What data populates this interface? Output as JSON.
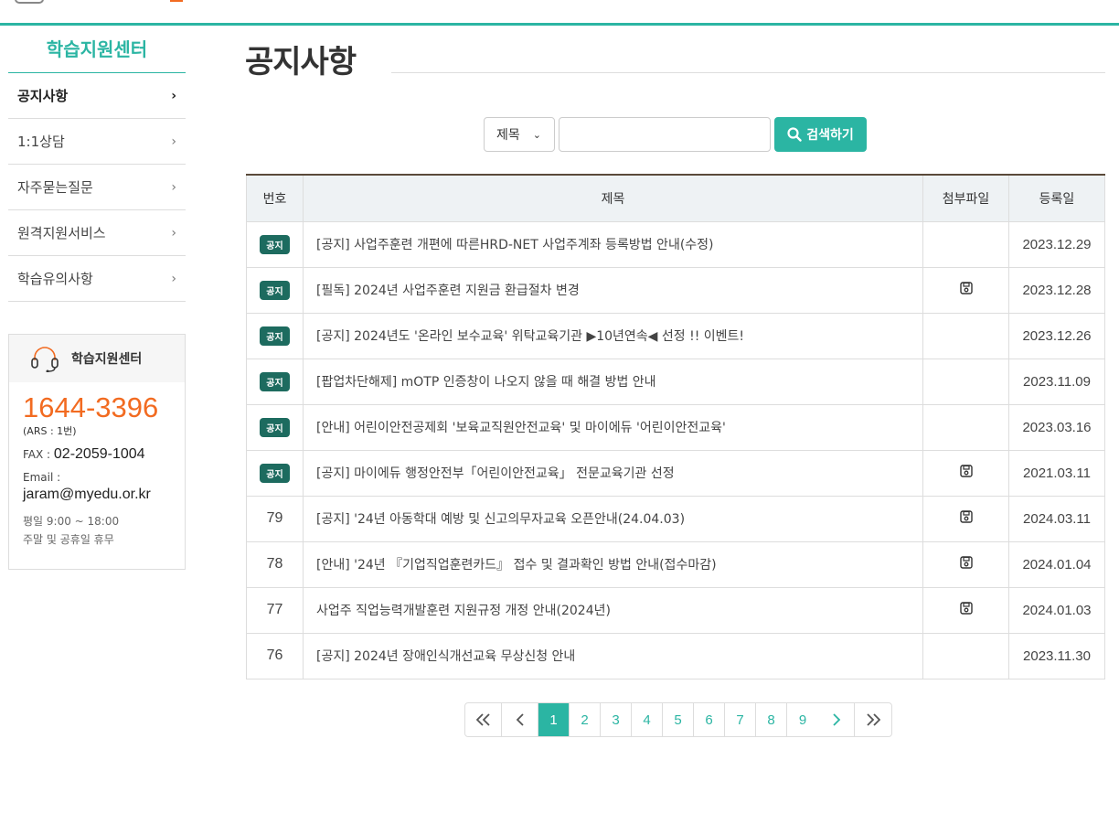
{
  "colors": {
    "accent": "#2bb5a3",
    "badge": "#1d6b5f",
    "phone": "#f26b21"
  },
  "sidebar": {
    "title": "학습지원센터",
    "items": [
      {
        "label": "공지사항",
        "active": true
      },
      {
        "label": "1:1상담"
      },
      {
        "label": "자주묻는질문"
      },
      {
        "label": "원격지원서비스"
      },
      {
        "label": "학습유의사항"
      }
    ]
  },
  "support": {
    "title": "학습지원센터",
    "phone": "1644-3396",
    "ars": "(ARS : 1번)",
    "fax_label": "FAX : ",
    "fax": "02-2059-1004",
    "email_label": "Email :",
    "email": "jaram@myedu.or.kr",
    "hours_weekday": "평일 9:00 ~ 18:00",
    "hours_weekend": "주말 및 공휴일 휴무"
  },
  "page": {
    "title": "공지사항"
  },
  "search": {
    "select_value": "제목",
    "input_value": "",
    "button_label": "검색하기"
  },
  "table": {
    "headers": [
      "번호",
      "제목",
      "첨부파일",
      "등록일"
    ],
    "rows": [
      {
        "num": "공지",
        "notice": true,
        "title": "[공지] 사업주훈련 개편에 따른HRD-NET 사업주계좌 등록방법 안내(수정)",
        "file": false,
        "date": "2023.12.29"
      },
      {
        "num": "공지",
        "notice": true,
        "title": "[필독] 2024년 사업주훈련 지원금 환급절차 변경",
        "file": true,
        "date": "2023.12.28"
      },
      {
        "num": "공지",
        "notice": true,
        "title": "[공지] 2024년도 '온라인 보수교육' 위탁교육기관 ▶10년연속◀ 선정 !! 이벤트!",
        "file": false,
        "date": "2023.12.26"
      },
      {
        "num": "공지",
        "notice": true,
        "title": "[팝업차단해제] mOTP 인증창이 나오지 않을 때 해결 방법 안내",
        "file": false,
        "date": "2023.11.09"
      },
      {
        "num": "공지",
        "notice": true,
        "title": "[안내] 어린이안전공제회 '보육교직원안전교육' 및 마이에듀 '어린이안전교육'",
        "file": false,
        "date": "2023.03.16"
      },
      {
        "num": "공지",
        "notice": true,
        "title": "[공지] 마이에듀 행정안전부「어린이안전교육」 전문교육기관 선정",
        "file": true,
        "date": "2021.03.11"
      },
      {
        "num": "79",
        "notice": false,
        "title": "[공지] '24년 아동학대 예방 및 신고의무자교육 오픈안내(24.04.03)",
        "file": true,
        "date": "2024.03.11"
      },
      {
        "num": "78",
        "notice": false,
        "title": "[안내] '24년 『기업직업훈련카드』 접수 및 결과확인 방법 안내(접수마감)",
        "file": true,
        "date": "2024.01.04"
      },
      {
        "num": "77",
        "notice": false,
        "title": "사업주 직업능력개발훈련 지원규정 개정 안내(2024년)",
        "file": true,
        "date": "2024.01.03"
      },
      {
        "num": "76",
        "notice": false,
        "title": "[공지] 2024년 장애인식개선교육 무상신청 안내",
        "file": false,
        "date": "2023.11.30"
      }
    ]
  },
  "pagination": {
    "pages": [
      "1",
      "2",
      "3",
      "4",
      "5",
      "6",
      "7",
      "8",
      "9"
    ],
    "current": "1",
    "first": "«",
    "prev": "‹",
    "next": "›",
    "last": "»"
  }
}
